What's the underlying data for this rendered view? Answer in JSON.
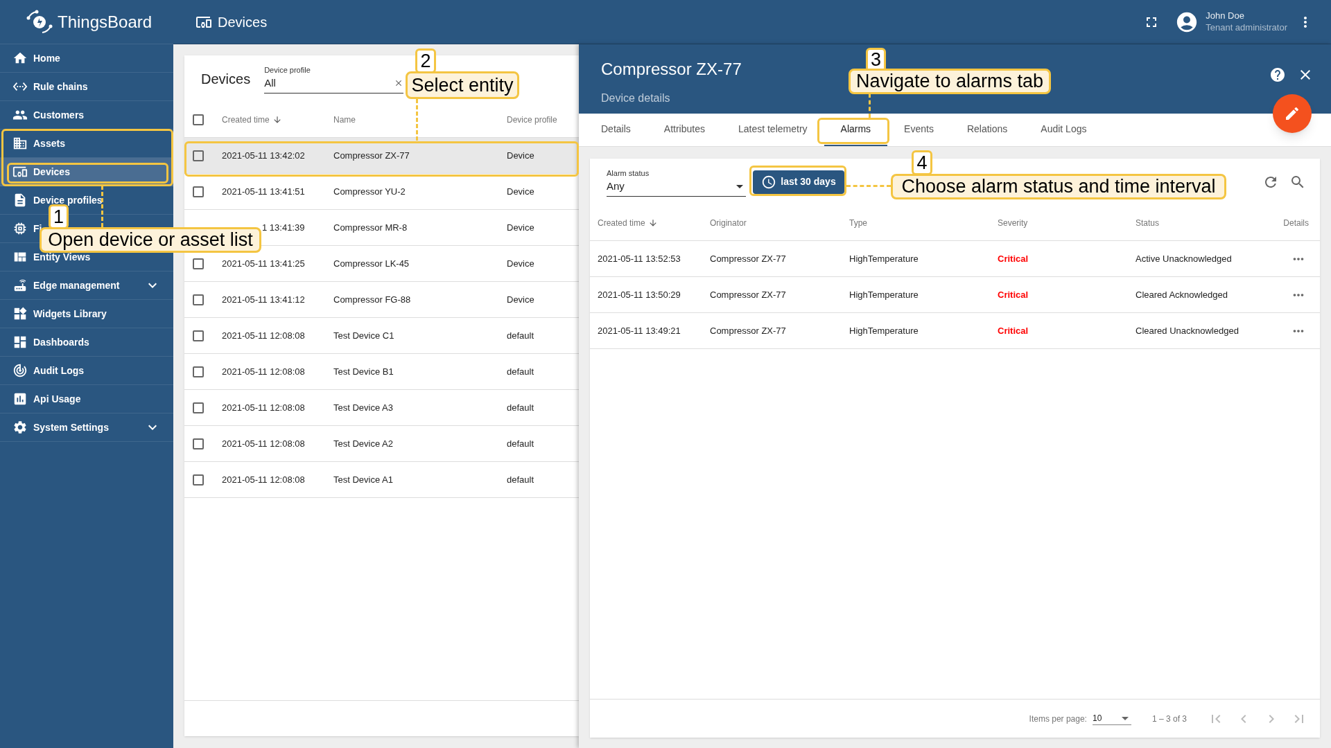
{
  "app": {
    "name": "ThingsBoard"
  },
  "topbar": {
    "title": "Devices",
    "user_name": "John Doe",
    "user_role": "Tenant administrator"
  },
  "sidebar": {
    "items": [
      {
        "label": "Home",
        "selected": false,
        "expandable": false
      },
      {
        "label": "Rule chains",
        "selected": false,
        "expandable": false
      },
      {
        "label": "Customers",
        "selected": false,
        "expandable": false
      },
      {
        "label": "Assets",
        "selected": false,
        "expandable": false
      },
      {
        "label": "Devices",
        "selected": true,
        "expandable": false
      },
      {
        "label": "Device profiles",
        "selected": false,
        "expandable": false
      },
      {
        "label": "Fi",
        "selected": false,
        "expandable": false
      },
      {
        "label": "Entity Views",
        "selected": false,
        "expandable": false
      },
      {
        "label": "Edge management",
        "selected": false,
        "expandable": true
      },
      {
        "label": "Widgets Library",
        "selected": false,
        "expandable": false
      },
      {
        "label": "Dashboards",
        "selected": false,
        "expandable": false
      },
      {
        "label": "Audit Logs",
        "selected": false,
        "expandable": false
      },
      {
        "label": "Api Usage",
        "selected": false,
        "expandable": false
      },
      {
        "label": "System Settings",
        "selected": false,
        "expandable": true
      }
    ]
  },
  "devices_panel": {
    "title": "Devices",
    "filter": {
      "label": "Device profile",
      "value": "All"
    },
    "all_checked": false,
    "columns": [
      "Created time",
      "Name",
      "Device profile"
    ],
    "rows": [
      {
        "created": "2021-05-11 13:42:02",
        "name": "Compressor ZX-77",
        "profile": "Device",
        "selected": true,
        "checked": false
      },
      {
        "created": "2021-05-11 13:41:51",
        "name": "Compressor YU-2",
        "profile": "Device",
        "selected": false,
        "checked": false
      },
      {
        "created": "1 13:41:39",
        "name": "Compressor MR-8",
        "profile": "Device",
        "selected": false
      },
      {
        "created": "2021-05-11 13:41:25",
        "name": "Compressor LK-45",
        "profile": "Device",
        "selected": false,
        "checked": false
      },
      {
        "created": "2021-05-11 13:41:12",
        "name": "Compressor FG-88",
        "profile": "Device",
        "selected": false,
        "checked": false
      },
      {
        "created": "2021-05-11 12:08:08",
        "name": "Test Device C1",
        "profile": "default",
        "selected": false,
        "checked": false
      },
      {
        "created": "2021-05-11 12:08:08",
        "name": "Test Device B1",
        "profile": "default",
        "selected": false,
        "checked": false
      },
      {
        "created": "2021-05-11 12:08:08",
        "name": "Test Device A3",
        "profile": "default",
        "selected": false,
        "checked": false
      },
      {
        "created": "2021-05-11 12:08:08",
        "name": "Test Device A2",
        "profile": "default",
        "selected": false,
        "checked": false
      },
      {
        "created": "2021-05-11 12:08:08",
        "name": "Test Device A1",
        "profile": "default",
        "selected": false,
        "checked": false
      }
    ]
  },
  "details": {
    "title": "Compressor ZX-77",
    "subtitle": "Device details",
    "tabs": [
      {
        "label": "Details",
        "selected": false
      },
      {
        "label": "Attributes",
        "selected": false
      },
      {
        "label": "Latest telemetry",
        "selected": false
      },
      {
        "label": "Alarms",
        "selected": true
      },
      {
        "label": "Events",
        "selected": false
      },
      {
        "label": "Relations",
        "selected": false
      },
      {
        "label": "Audit Logs",
        "selected": false
      }
    ],
    "alarm_filter": {
      "label": "Alarm status",
      "value": "Any"
    },
    "time_button": "last 30 days",
    "columns": [
      "Created time",
      "Originator",
      "Type",
      "Severity",
      "Status",
      "Details"
    ],
    "rows": [
      {
        "created": "2021-05-11 13:52:53",
        "originator": "Compressor ZX-77",
        "type": "HighTemperature",
        "severity": "Critical",
        "status": "Active Unacknowledged"
      },
      {
        "created": "2021-05-11 13:50:29",
        "originator": "Compressor ZX-77",
        "type": "HighTemperature",
        "severity": "Critical",
        "status": "Cleared Acknowledged"
      },
      {
        "created": "2021-05-11 13:49:21",
        "originator": "Compressor ZX-77",
        "type": "HighTemperature",
        "severity": "Critical",
        "status": "Cleared Unacknowledged"
      }
    ],
    "paginator": {
      "label": "Items per page:",
      "page_size": "10",
      "range": "1 – 3 of 3"
    }
  },
  "callouts": [
    {
      "number": "1",
      "text": "Open device or asset list"
    },
    {
      "number": "2",
      "text": "Select entity"
    },
    {
      "number": "3",
      "text": "Navigate to alarms tab"
    },
    {
      "number": "4",
      "text": "Choose alarm status and time interval"
    }
  ]
}
